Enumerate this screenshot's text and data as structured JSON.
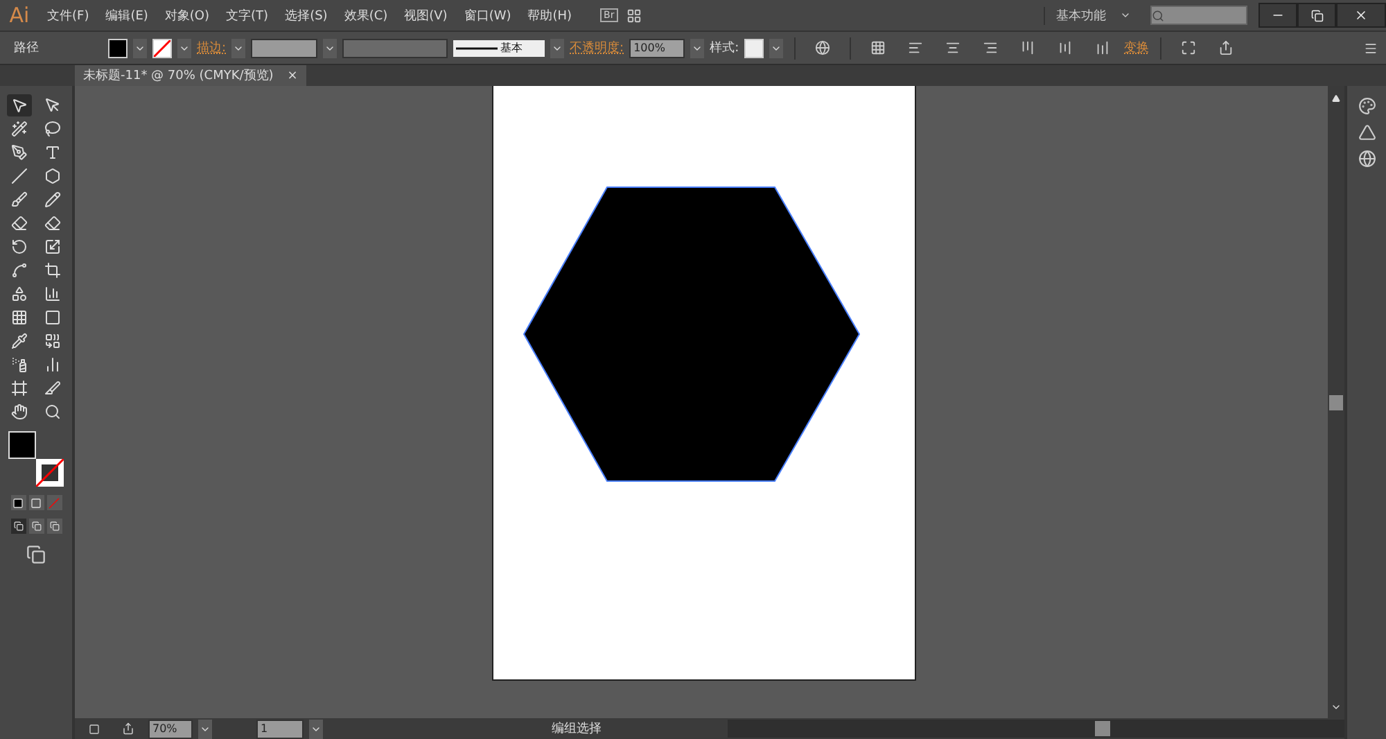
{
  "app_logo": "Ai",
  "menu": [
    "文件(F)",
    "编辑(E)",
    "对象(O)",
    "文字(T)",
    "选择(S)",
    "效果(C)",
    "视图(V)",
    "窗口(W)",
    "帮助(H)"
  ],
  "bridge_button": "Br",
  "workspace": "基本功能",
  "control_bar": {
    "selection_label": "路径",
    "stroke_label": "描边:",
    "stroke_style": "基本",
    "opacity_label": "不透明度:",
    "opacity_value": "100%",
    "style_label": "样式:",
    "transform_link": "变换"
  },
  "document_tab": {
    "title": "未标题-11* @ 70% (CMYK/预览)",
    "close": "×"
  },
  "tools": [
    {
      "selected": true
    },
    {
      "selected": false
    },
    {
      "selected": false
    },
    {
      "selected": false
    },
    {
      "selected": false
    },
    {
      "selected": false
    },
    {
      "selected": false
    },
    {
      "selected": false
    },
    {
      "selected": false
    },
    {
      "selected": false
    },
    {
      "selected": false
    },
    {
      "selected": false
    },
    {
      "selected": false
    },
    {
      "selected": false
    },
    {
      "selected": false
    },
    {
      "selected": false
    },
    {
      "selected": false
    },
    {
      "selected": false
    },
    {
      "selected": false
    },
    {
      "selected": false
    },
    {
      "selected": false
    },
    {
      "selected": false
    },
    {
      "selected": false
    },
    {
      "selected": false
    },
    {
      "selected": false
    },
    {
      "selected": false
    },
    {
      "selected": false
    },
    {
      "selected": false
    }
  ],
  "drawing_modes": [
    {
      "selected": true
    },
    {
      "selected": false
    },
    {
      "selected": false
    }
  ],
  "status_bar": {
    "zoom": "70%",
    "page": "1",
    "status": "编组选择"
  }
}
